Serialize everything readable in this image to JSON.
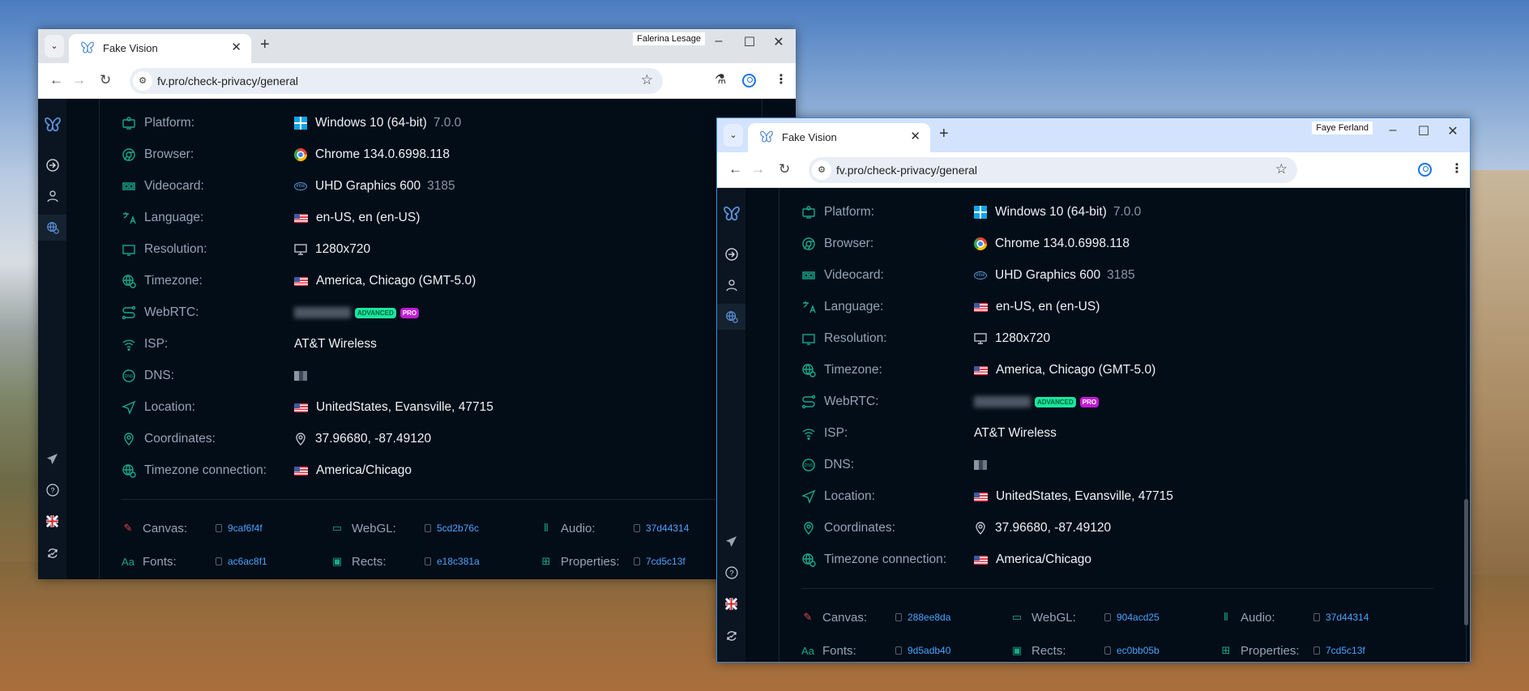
{
  "windows": [
    {
      "profile_name": "Falerina Lesage",
      "tab_title": "Fake Vision",
      "url": "fv.pro/check-privacy/general",
      "active": false,
      "rows": [
        {
          "key": "platform",
          "label": "Platform:",
          "value": "Windows 10 (64-bit)",
          "secondary": "7.0.0",
          "value_icon": "windows-icon"
        },
        {
          "key": "browser",
          "label": "Browser:",
          "value": "Chrome 134.0.6998.118",
          "value_icon": "chrome-icon"
        },
        {
          "key": "videocard",
          "label": "Videocard:",
          "value": "UHD Graphics 600",
          "secondary": "3185",
          "value_icon": "intel-icon"
        },
        {
          "key": "language",
          "label": "Language:",
          "value": "en-US, en (en-US)",
          "value_icon": "us-flag-icon"
        },
        {
          "key": "resolution",
          "label": "Resolution:",
          "value": "1280x720",
          "value_icon": "monitor-icon"
        },
        {
          "key": "timezone",
          "label": "Timezone:",
          "value": "America, Chicago (GMT-5.0)",
          "value_icon": "us-flag-icon"
        },
        {
          "key": "webrtc",
          "label": "WebRTC:",
          "blurred": true,
          "badges": [
            "ADVANCED",
            "PRO"
          ]
        },
        {
          "key": "isp",
          "label": "ISP:",
          "value": "AT&T Wireless"
        },
        {
          "key": "dns",
          "label": "DNS:",
          "dns_blurred": true
        },
        {
          "key": "location",
          "label": "Location:",
          "value": "UnitedStates, Evansville, 47715",
          "value_icon": "us-flag-icon"
        },
        {
          "key": "coordinates",
          "label": "Coordinates:",
          "value": "37.96680, -87.49120",
          "value_icon": "pin-icon"
        },
        {
          "key": "timezone-connection",
          "label": "Timezone connection:",
          "value": "America/Chicago",
          "value_icon": "us-flag-icon"
        }
      ],
      "fingerprints": [
        {
          "key": "canvas",
          "label": "Canvas:",
          "hash": "9caf6f4f"
        },
        {
          "key": "webgl",
          "label": "WebGL:",
          "hash": "5cd2b76c"
        },
        {
          "key": "audio",
          "label": "Audio:",
          "hash": "37d44314"
        },
        {
          "key": "fonts",
          "label": "Fonts:",
          "hash": "ac6ac8f1"
        },
        {
          "key": "rects",
          "label": "Rects:",
          "hash": "e18c381a"
        },
        {
          "key": "properties",
          "label": "Properties:",
          "hash": "7cd5c13f"
        }
      ]
    },
    {
      "profile_name": "Faye Ferland",
      "tab_title": "Fake Vision",
      "url": "fv.pro/check-privacy/general",
      "active": true,
      "rows": [
        {
          "key": "platform",
          "label": "Platform:",
          "value": "Windows 10 (64-bit)",
          "secondary": "7.0.0",
          "value_icon": "windows-icon"
        },
        {
          "key": "browser",
          "label": "Browser:",
          "value": "Chrome 134.0.6998.118",
          "value_icon": "chrome-icon"
        },
        {
          "key": "videocard",
          "label": "Videocard:",
          "value": "UHD Graphics 600",
          "secondary": "3185",
          "value_icon": "intel-icon"
        },
        {
          "key": "language",
          "label": "Language:",
          "value": "en-US, en (en-US)",
          "value_icon": "us-flag-icon"
        },
        {
          "key": "resolution",
          "label": "Resolution:",
          "value": "1280x720",
          "value_icon": "monitor-icon"
        },
        {
          "key": "timezone",
          "label": "Timezone:",
          "value": "America, Chicago (GMT-5.0)",
          "value_icon": "us-flag-icon"
        },
        {
          "key": "webrtc",
          "label": "WebRTC:",
          "blurred": true,
          "badges": [
            "ADVANCED",
            "PRO"
          ]
        },
        {
          "key": "isp",
          "label": "ISP:",
          "value": "AT&T Wireless"
        },
        {
          "key": "dns",
          "label": "DNS:",
          "dns_blurred": true
        },
        {
          "key": "location",
          "label": "Location:",
          "value": "UnitedStates, Evansville, 47715",
          "value_icon": "us-flag-icon"
        },
        {
          "key": "coordinates",
          "label": "Coordinates:",
          "value": "37.96680, -87.49120",
          "value_icon": "pin-icon"
        },
        {
          "key": "timezone-connection",
          "label": "Timezone connection:",
          "value": "America/Chicago",
          "value_icon": "us-flag-icon"
        }
      ],
      "fingerprints": [
        {
          "key": "canvas",
          "label": "Canvas:",
          "hash": "288ee8da"
        },
        {
          "key": "webgl",
          "label": "WebGL:",
          "hash": "904acd25"
        },
        {
          "key": "audio",
          "label": "Audio:",
          "hash": "37d44314"
        },
        {
          "key": "fonts",
          "label": "Fonts:",
          "hash": "9d5adb40"
        },
        {
          "key": "rects",
          "label": "Rects:",
          "hash": "ec0bb05b"
        },
        {
          "key": "properties",
          "label": "Properties:",
          "hash": "7cd5c13f"
        }
      ]
    }
  ],
  "colors": {
    "accent": "#1aa88a",
    "hash_link": "#4ba3ff",
    "badge_advanced": "#19e6a0",
    "badge_pro": "#c21ad6",
    "page_bg": "#030d18"
  }
}
